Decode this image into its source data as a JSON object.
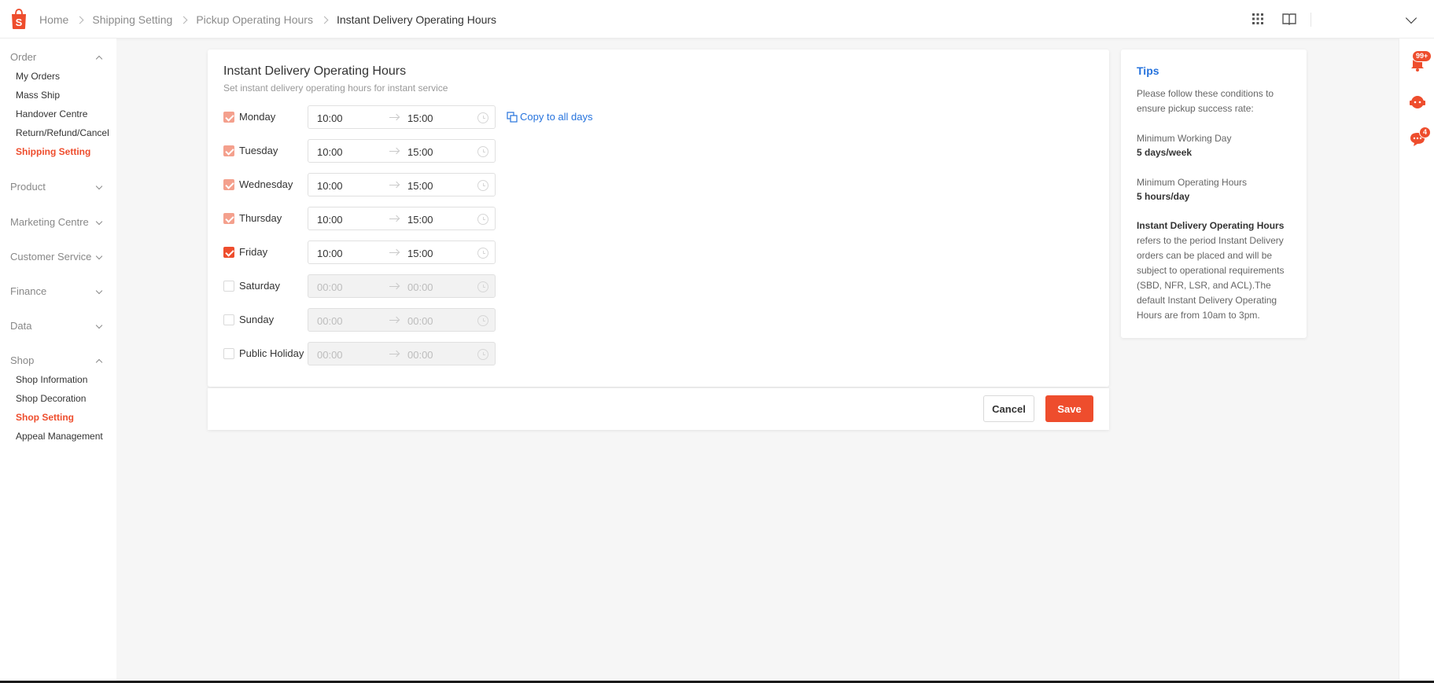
{
  "header": {
    "breadcrumb": [
      "Home",
      "Shipping Setting",
      "Pickup Operating Hours",
      "Instant Delivery Operating Hours"
    ]
  },
  "sidebar": {
    "groups": [
      {
        "label": "Order",
        "expanded": true,
        "items": [
          {
            "label": "My Orders",
            "active": false
          },
          {
            "label": "Mass Ship",
            "active": false
          },
          {
            "label": "Handover Centre",
            "active": false
          },
          {
            "label": "Return/Refund/Cancel",
            "active": false
          },
          {
            "label": "Shipping Setting",
            "active": true
          }
        ]
      },
      {
        "label": "Product",
        "expanded": false,
        "items": []
      },
      {
        "label": "Marketing Centre",
        "expanded": false,
        "items": []
      },
      {
        "label": "Customer Service",
        "expanded": false,
        "items": []
      },
      {
        "label": "Finance",
        "expanded": false,
        "items": []
      },
      {
        "label": "Data",
        "expanded": false,
        "items": []
      },
      {
        "label": "Shop",
        "expanded": true,
        "items": [
          {
            "label": "Shop Information",
            "active": false
          },
          {
            "label": "Shop Decoration",
            "active": false
          },
          {
            "label": "Shop Setting",
            "active": true
          },
          {
            "label": "Appeal Management",
            "active": false
          }
        ]
      }
    ]
  },
  "rail": {
    "notification_badge": "99+",
    "chat_badge": "4"
  },
  "main": {
    "title": "Instant Delivery Operating Hours",
    "subtitle": "Set instant delivery operating hours for instant service",
    "copy_label": "Copy to all days",
    "days": [
      {
        "label": "Monday",
        "checked": true,
        "start": "10:00",
        "end": "15:00"
      },
      {
        "label": "Tuesday",
        "checked": true,
        "start": "10:00",
        "end": "15:00"
      },
      {
        "label": "Wednesday",
        "checked": true,
        "start": "10:00",
        "end": "15:00"
      },
      {
        "label": "Thursday",
        "checked": true,
        "start": "10:00",
        "end": "15:00"
      },
      {
        "label": "Friday",
        "checked": true,
        "start": "10:00",
        "end": "15:00"
      },
      {
        "label": "Saturday",
        "checked": false,
        "start": "00:00",
        "end": "00:00"
      },
      {
        "label": "Sunday",
        "checked": false,
        "start": "00:00",
        "end": "00:00"
      },
      {
        "label": "Public Holiday",
        "checked": false,
        "start": "00:00",
        "end": "00:00"
      }
    ],
    "cancel_label": "Cancel",
    "save_label": "Save"
  },
  "tips": {
    "title": "Tips",
    "intro": "Please follow these conditions to ensure pickup success rate:",
    "min_day_label": "Minimum Working Day",
    "min_day_value": "5 days/week",
    "min_hours_label": "Minimum Operating Hours",
    "min_hours_value": "5 hours/day",
    "instant_title": "Instant Delivery Operating Hours",
    "instant_text": "refers to the period Instant Delivery orders can be placed and will be subject to operational requirements (SBD, NFR, LSR, and ACL).The default Instant Delivery Operating Hours are from 10am to 3pm."
  },
  "colors": {
    "brand": "#ee4d2d",
    "link": "#2673dd"
  }
}
